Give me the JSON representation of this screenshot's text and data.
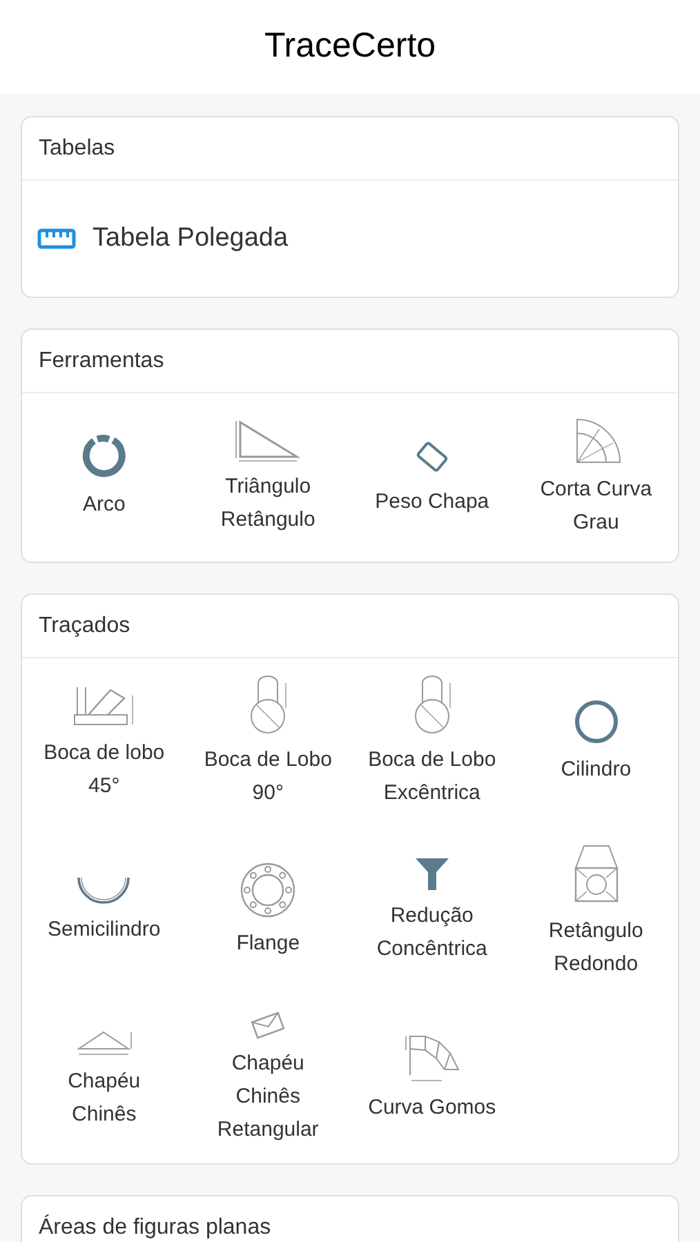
{
  "header": {
    "title": "TraceCerto"
  },
  "sections": [
    {
      "title": "Tabelas",
      "kind": "list",
      "items": [
        {
          "label": "Tabela Polegada",
          "kind": "ruler"
        }
      ]
    },
    {
      "title": "Ferramentas",
      "kind": "grid",
      "items": [
        {
          "label": "Arco",
          "kind": "ring-gap"
        },
        {
          "label": "Triângulo Retângulo",
          "kind": "triangle"
        },
        {
          "label": "Peso Chapa",
          "kind": "plate"
        },
        {
          "label": "Corta Curva Grau",
          "kind": "quarter"
        }
      ]
    },
    {
      "title": "Traçados",
      "kind": "grid",
      "items": [
        {
          "label": "Boca de lobo 45°",
          "kind": "pipe45"
        },
        {
          "label": "Boca de Lobo 90°",
          "kind": "pipe90"
        },
        {
          "label": "Boca de Lobo Excêntrica",
          "kind": "pipe90"
        },
        {
          "label": "Cilindro",
          "kind": "circle"
        },
        {
          "label": "Semicilindro",
          "kind": "half"
        },
        {
          "label": "Flange",
          "kind": "flange"
        },
        {
          "label": "Redução Concêntrica",
          "kind": "funnel"
        },
        {
          "label": "Retângulo Redondo",
          "kind": "square-round"
        },
        {
          "label": "Chapéu Chinês",
          "kind": "cone"
        },
        {
          "label": "Chapéu Chinês Retangular",
          "kind": "envelope"
        },
        {
          "label": "Curva Gomos",
          "kind": "segments"
        }
      ]
    },
    {
      "title": "Áreas de figuras planas",
      "kind": "grid"
    }
  ]
}
